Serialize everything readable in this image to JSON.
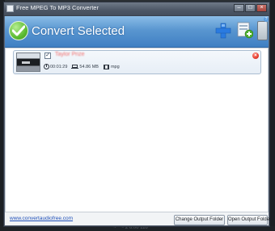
{
  "window": {
    "title": "Free MPEG To MP3 Converter",
    "controls": [
      "–",
      "□",
      "×"
    ]
  },
  "header": {
    "title": "Convert Selected",
    "help": "?"
  },
  "file": {
    "checked": "✓",
    "name": "Taylor Prize",
    "duration": "00:01:29",
    "size": "54.86 MB",
    "format": "mpg"
  },
  "footer": {
    "link": "www.convertaudiofree.com",
    "change_output_folder": "Change Output Folder",
    "open_output_folder": "Open Output Folder"
  },
  "desktop": {
    "taskbar_text": "~ ^ ~ 2  6.06 116"
  },
  "colors": {
    "header_blue": "#4f8ccb",
    "check_green": "#5cbc33",
    "remove_red": "#e23b2e",
    "link_blue": "#1f4fb8"
  }
}
